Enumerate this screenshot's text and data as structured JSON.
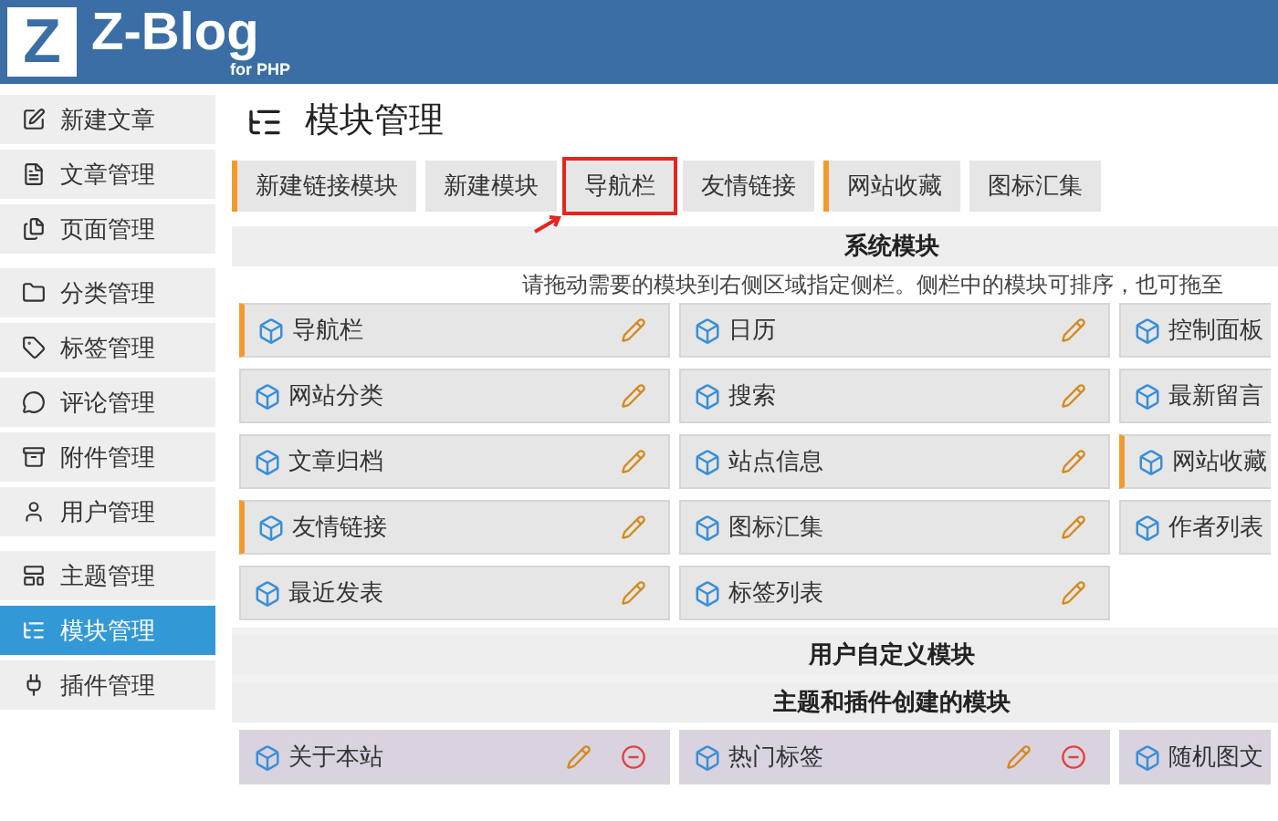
{
  "logo": {
    "mark": "Z",
    "name": "Z-Blog",
    "sub": "for PHP"
  },
  "sidebar": {
    "groups": [
      {
        "items": [
          {
            "label": "新建文章",
            "selected": false
          },
          {
            "label": "文章管理",
            "selected": false
          },
          {
            "label": "页面管理",
            "selected": false
          }
        ]
      },
      {
        "items": [
          {
            "label": "分类管理",
            "selected": false
          },
          {
            "label": "标签管理",
            "selected": false
          },
          {
            "label": "评论管理",
            "selected": false
          },
          {
            "label": "附件管理",
            "selected": false
          },
          {
            "label": "用户管理",
            "selected": false
          }
        ]
      },
      {
        "items": [
          {
            "label": "主题管理",
            "selected": false
          },
          {
            "label": "模块管理",
            "selected": true
          },
          {
            "label": "插件管理",
            "selected": false
          }
        ]
      }
    ]
  },
  "page_title": "模块管理",
  "tabs": [
    {
      "label": "新建链接模块",
      "highlighted": true,
      "selected": false
    },
    {
      "label": "新建模块",
      "highlighted": false,
      "selected": false
    },
    {
      "label": "导航栏",
      "highlighted": false,
      "selected": true
    },
    {
      "label": "友情链接",
      "highlighted": false,
      "selected": false
    },
    {
      "label": "网站收藏",
      "highlighted": true,
      "selected": false
    },
    {
      "label": "图标汇集",
      "highlighted": false,
      "selected": false
    }
  ],
  "system_section": {
    "title": "系统模块",
    "hint": "请拖动需要的模块到右侧区域指定侧栏。侧栏中的模块可排序，也可拖至",
    "modules": [
      {
        "label": "导航栏",
        "highlighted": true
      },
      {
        "label": "日历",
        "highlighted": false
      },
      {
        "label": "控制面板",
        "highlighted": false
      },
      {
        "label": "网站分类",
        "highlighted": false
      },
      {
        "label": "搜索",
        "highlighted": false
      },
      {
        "label": "最新留言",
        "highlighted": false
      },
      {
        "label": "文章归档",
        "highlighted": false
      },
      {
        "label": "站点信息",
        "highlighted": false
      },
      {
        "label": "网站收藏",
        "highlighted": true
      },
      {
        "label": "友情链接",
        "highlighted": true
      },
      {
        "label": "图标汇集",
        "highlighted": false
      },
      {
        "label": "作者列表",
        "highlighted": false
      },
      {
        "label": "最近发表",
        "highlighted": false
      },
      {
        "label": "标签列表",
        "highlighted": false
      }
    ]
  },
  "user_section": {
    "title": "用户自定义模块"
  },
  "theme_section": {
    "title": "主题和插件创建的模块",
    "modules": [
      {
        "label": "关于本站",
        "highlighted": false
      },
      {
        "label": "热门标签",
        "highlighted": false
      },
      {
        "label": "随机图文",
        "highlighted": false
      }
    ]
  }
}
